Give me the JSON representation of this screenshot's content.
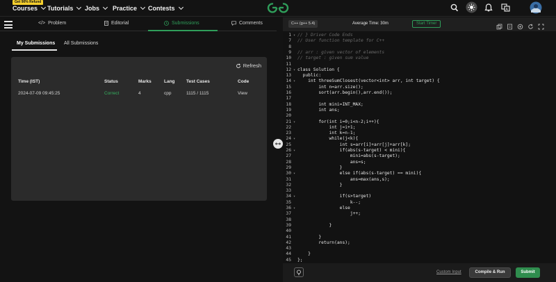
{
  "nav": {
    "promo": "Get 90% Refund",
    "items": [
      "Courses",
      "Tutorials",
      "Jobs",
      "Practice",
      "Contests"
    ],
    "logo_icon": "gfg-logo-icon",
    "icons": [
      "search-icon",
      "theme-toggle-icon",
      "bell-icon",
      "translate-icon",
      "avatar"
    ]
  },
  "problem_tabs": [
    {
      "label": "Problem",
      "icon": "code-icon"
    },
    {
      "label": "Editorial",
      "icon": "doc-icon"
    },
    {
      "label": "Submissions",
      "icon": "clock-icon"
    },
    {
      "label": "Comments",
      "icon": "comment-icon"
    }
  ],
  "submission_tabs": {
    "mine": "My Submissions",
    "all": "All Submissions"
  },
  "submissions": {
    "refresh_label": "Refresh",
    "headers": [
      "Time (IST)",
      "Status",
      "Marks",
      "Lang",
      "Test Cases",
      "Code"
    ],
    "rows": [
      {
        "time": "2024-07-09 09:45:25",
        "status": "Correct",
        "marks": "4",
        "lang": "cpp",
        "tests": "1115 / 1115",
        "code": "View"
      }
    ]
  },
  "editor": {
    "language": "C++ (g++ 5.4)",
    "average_time": "Average Time: 30m",
    "timer": "Start Timer",
    "lines": [
      {
        "n": "1",
        "t": "// } Driver Code Ends",
        "c": true
      },
      {
        "n": "7",
        "t": "// User function template for C++",
        "c": true
      },
      {
        "n": "8",
        "t": ""
      },
      {
        "n": "9",
        "t": "// arr : given vector of elements",
        "c": true
      },
      {
        "n": "10",
        "t": "// target : given sum value",
        "c": true
      },
      {
        "n": "11",
        "t": ""
      },
      {
        "n": "12",
        "t": "class Solution {"
      },
      {
        "n": "13",
        "t": "  public:"
      },
      {
        "n": "14",
        "t": "    int threeSumClosest(vector<int> arr, int target) {"
      },
      {
        "n": "15",
        "t": "        int n=arr.size();"
      },
      {
        "n": "16",
        "t": "        sort(arr.begin(),arr.end());"
      },
      {
        "n": "17",
        "t": ""
      },
      {
        "n": "18",
        "t": "        int mini=INT_MAX;"
      },
      {
        "n": "19",
        "t": "        int ans;"
      },
      {
        "n": "20",
        "t": ""
      },
      {
        "n": "21",
        "t": "        for(int i=0;i<n-2;i++){"
      },
      {
        "n": "22",
        "t": "            int j=i+1;"
      },
      {
        "n": "23",
        "t": "            int k=n-1;"
      },
      {
        "n": "24",
        "t": "            while(j<k){"
      },
      {
        "n": "25",
        "t": "                int s=arr[i]+arr[j]+arr[k];"
      },
      {
        "n": "26",
        "t": "                if(abs(s-target) < mini){"
      },
      {
        "n": "27",
        "t": "                    mini=abs(s-target);"
      },
      {
        "n": "28",
        "t": "                    ans=s;"
      },
      {
        "n": "29",
        "t": "                }"
      },
      {
        "n": "30",
        "t": "                else if(abs(s-target) == mini){"
      },
      {
        "n": "31",
        "t": "                    ans=max(ans,s);"
      },
      {
        "n": "32",
        "t": "                }"
      },
      {
        "n": "33",
        "t": ""
      },
      {
        "n": "34",
        "t": "                if(s>target)"
      },
      {
        "n": "35",
        "t": "                    k--;"
      },
      {
        "n": "36",
        "t": "                else"
      },
      {
        "n": "37",
        "t": "                    j++;"
      },
      {
        "n": "38",
        "t": ""
      },
      {
        "n": "39",
        "t": "            }"
      },
      {
        "n": "40",
        "t": ""
      },
      {
        "n": "41",
        "t": "        }"
      },
      {
        "n": "42",
        "t": "        return(ans);"
      },
      {
        "n": "43",
        "t": ""
      },
      {
        "n": "44",
        "t": "    }"
      },
      {
        "n": "45",
        "t": "};"
      }
    ],
    "custom_input": "Custom Input",
    "compile_run": "Compile & Run",
    "submit": "Submit"
  },
  "colors": {
    "accent": "#2f9e5a",
    "promo": "#f5cf2e"
  }
}
